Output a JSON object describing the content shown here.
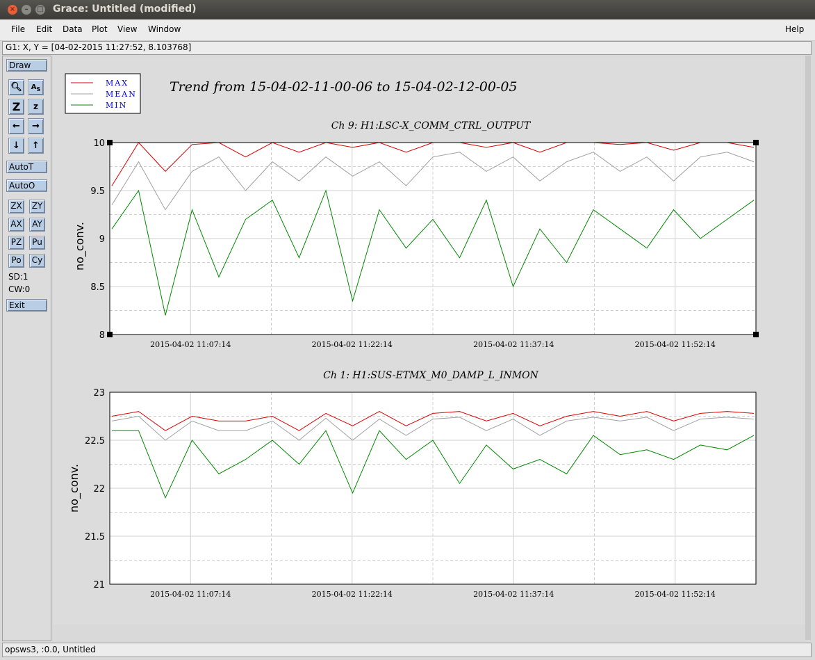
{
  "window": {
    "title": "Grace: Untitled (modified)"
  },
  "menu": {
    "file": "File",
    "edit": "Edit",
    "data": "Data",
    "plot": "Plot",
    "view": "View",
    "window": "Window",
    "help": "Help"
  },
  "coords": "G1: X, Y = [04-02-2015 11:27:52, 8.103768]",
  "toolbar": {
    "draw": "Draw",
    "autot": "AutoT",
    "autoo": "AutoO",
    "zx": "ZX",
    "zy": "ZY",
    "ax": "AX",
    "ay": "AY",
    "pz": "PZ",
    "pu": "Pu",
    "po": "Po",
    "cy": "Cy",
    "sd": "SD:1",
    "cw": "CW:0",
    "exit": "Exit"
  },
  "status": "opsws3, :0.0, Untitled",
  "colors": {
    "max": "#dd0000",
    "mean": "#a0a0a0",
    "min": "#008800"
  },
  "chart_data": [
    {
      "type": "line",
      "title": "Trend from 15-04-02-11-00-06 to 15-04-02-12-00-05",
      "subtitle": "Ch 9: H1:LSC-X_COMM_CTRL_OUTPUT",
      "ylabel": "no_conv.",
      "ylim": [
        8,
        10
      ],
      "yticks": [
        "8",
        "8.5",
        "9",
        "9.5",
        "10"
      ],
      "xticks": [
        "2015-04-02 11:07:14",
        "2015-04-02 11:22:14",
        "2015-04-02 11:37:14",
        "2015-04-02 11:52:14"
      ],
      "legend": [
        "MAX",
        "MEAN",
        "MIN"
      ],
      "series": [
        {
          "name": "MAX",
          "values": [
            9.55,
            10.0,
            9.7,
            9.98,
            10.0,
            9.85,
            10.0,
            9.9,
            10.0,
            9.95,
            10.0,
            9.9,
            10.0,
            10.0,
            9.95,
            10.0,
            9.9,
            10.0,
            10.0,
            9.98,
            10.0,
            9.92,
            10.0,
            10.0,
            9.95
          ]
        },
        {
          "name": "MEAN",
          "values": [
            9.35,
            9.8,
            9.3,
            9.7,
            9.85,
            9.5,
            9.8,
            9.6,
            9.85,
            9.65,
            9.8,
            9.55,
            9.85,
            9.9,
            9.7,
            9.85,
            9.6,
            9.8,
            9.9,
            9.7,
            9.85,
            9.6,
            9.85,
            9.9,
            9.8
          ]
        },
        {
          "name": "MIN",
          "values": [
            9.1,
            9.5,
            8.2,
            9.3,
            8.6,
            9.2,
            9.4,
            8.8,
            9.5,
            8.35,
            9.3,
            8.9,
            9.2,
            8.8,
            9.4,
            8.5,
            9.1,
            8.75,
            9.3,
            9.1,
            8.9,
            9.3,
            9.0,
            9.2,
            9.4
          ]
        }
      ]
    },
    {
      "type": "line",
      "subtitle": "Ch 1: H1:SUS-ETMX_M0_DAMP_L_INMON",
      "ylabel": "no_conv.",
      "ylim": [
        21,
        23
      ],
      "yticks": [
        "21",
        "21.5",
        "22",
        "22.5",
        "23"
      ],
      "xticks": [
        "2015-04-02 11:07:14",
        "2015-04-02 11:22:14",
        "2015-04-02 11:37:14",
        "2015-04-02 11:52:14"
      ],
      "series": [
        {
          "name": "MAX",
          "values": [
            22.75,
            22.8,
            22.6,
            22.75,
            22.7,
            22.7,
            22.75,
            22.6,
            22.78,
            22.65,
            22.8,
            22.65,
            22.78,
            22.8,
            22.7,
            22.78,
            22.65,
            22.75,
            22.8,
            22.75,
            22.8,
            22.7,
            22.78,
            22.8,
            22.78
          ]
        },
        {
          "name": "MEAN",
          "values": [
            22.7,
            22.75,
            22.5,
            22.7,
            22.6,
            22.6,
            22.7,
            22.5,
            22.73,
            22.5,
            22.72,
            22.55,
            22.72,
            22.74,
            22.6,
            22.72,
            22.55,
            22.7,
            22.74,
            22.7,
            22.74,
            22.6,
            22.72,
            22.74,
            22.72
          ]
        },
        {
          "name": "MIN",
          "values": [
            22.6,
            22.6,
            21.9,
            22.5,
            22.15,
            22.3,
            22.5,
            22.25,
            22.6,
            21.95,
            22.6,
            22.3,
            22.5,
            22.05,
            22.45,
            22.2,
            22.3,
            22.15,
            22.55,
            22.35,
            22.4,
            22.3,
            22.45,
            22.4,
            22.55
          ]
        }
      ]
    }
  ]
}
